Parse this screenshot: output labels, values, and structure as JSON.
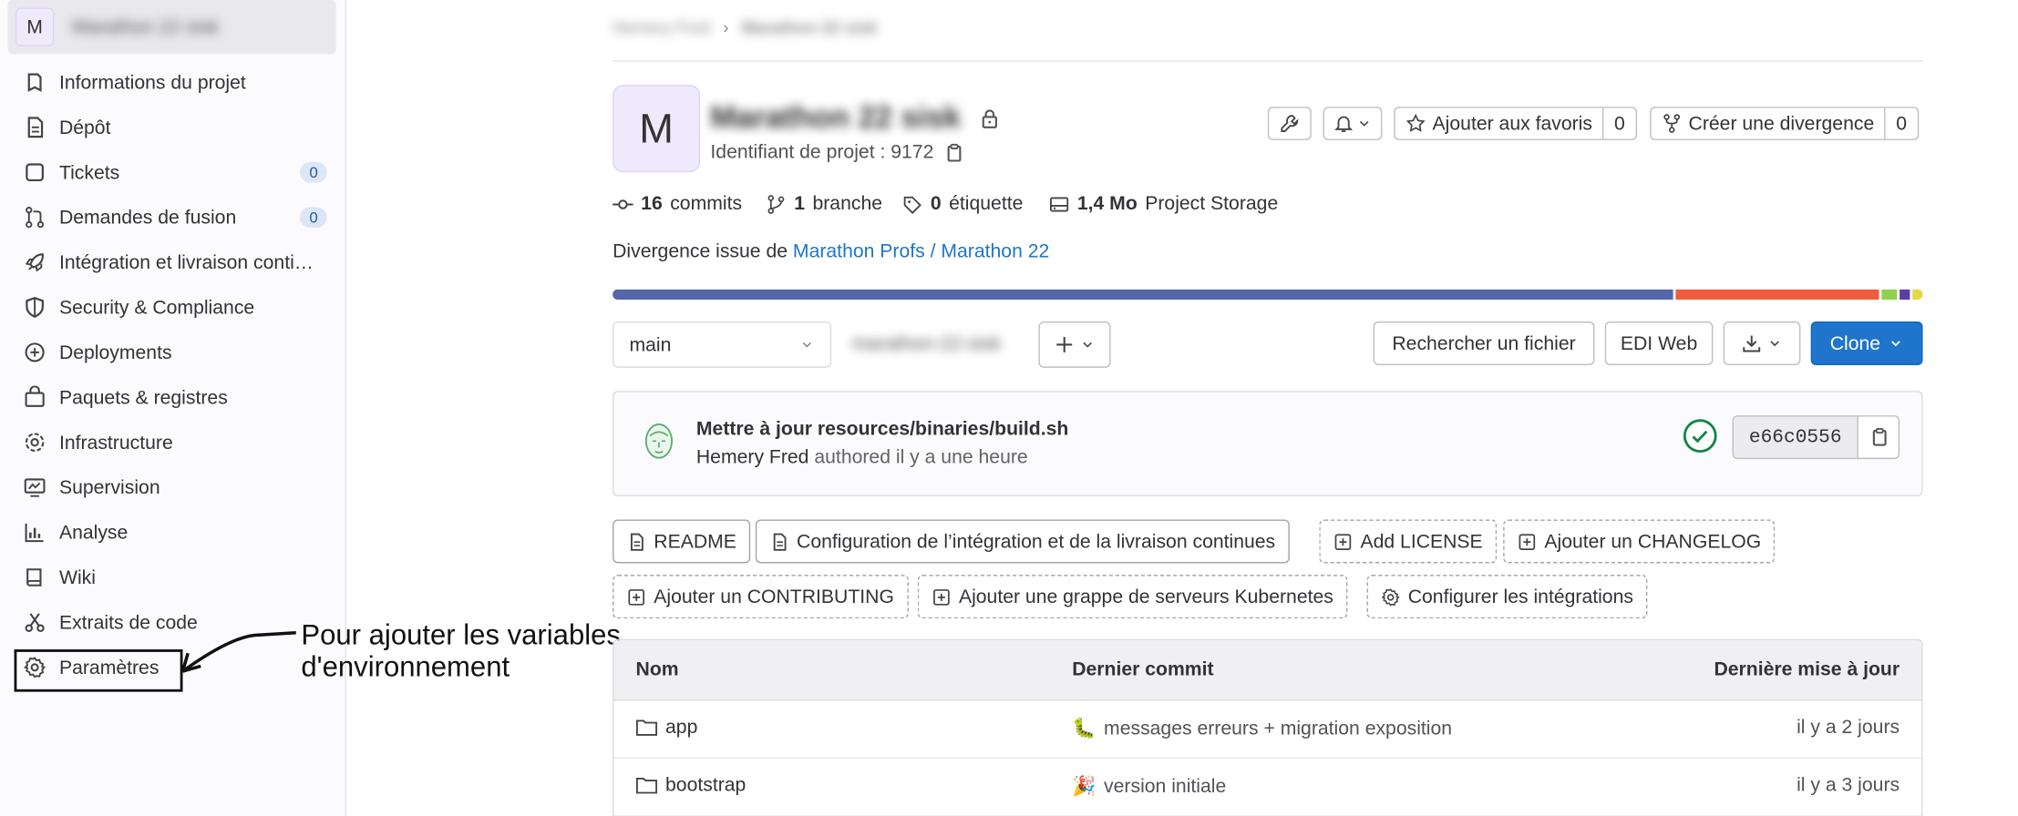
{
  "sidebar": {
    "context_avatar": "M",
    "context_name": "Marathon 22 sisk",
    "items": [
      {
        "label": "Informations du projet",
        "icon": "project-icon"
      },
      {
        "label": "Dépôt",
        "icon": "document-icon"
      },
      {
        "label": "Tickets",
        "icon": "issues-icon",
        "badge": "0"
      },
      {
        "label": "Demandes de fusion",
        "icon": "merge-request-icon",
        "badge": "0"
      },
      {
        "label": "Intégration et livraison conti…",
        "icon": "rocket-icon"
      },
      {
        "label": "Security & Compliance",
        "icon": "shield-icon"
      },
      {
        "label": "Deployments",
        "icon": "deployments-icon"
      },
      {
        "label": "Paquets & registres",
        "icon": "package-icon"
      },
      {
        "label": "Infrastructure",
        "icon": "cloud-gear-icon"
      },
      {
        "label": "Supervision",
        "icon": "monitor-icon"
      },
      {
        "label": "Analyse",
        "icon": "chart-icon"
      },
      {
        "label": "Wiki",
        "icon": "book-icon"
      },
      {
        "label": "Extraits de code",
        "icon": "snippet-icon"
      },
      {
        "label": "Paramètres",
        "icon": "gear-icon"
      }
    ]
  },
  "annotation": {
    "line1": "Pour ajouter les variables",
    "line2": "d'environnement"
  },
  "breadcrumb": {
    "parent": "Hemery Fred",
    "current": "Marathon 22 sisk"
  },
  "project": {
    "avatar": "M",
    "name": "Marathon 22 sisk",
    "id_label": "Identifiant de projet : 9172",
    "favorite_label": "Ajouter aux favoris",
    "favorite_count": "0",
    "fork_label": "Créer une divergence",
    "fork_count": "0"
  },
  "stats": {
    "commits_num": "16",
    "commits_label": "commits",
    "branches_num": "1",
    "branches_label": "branche",
    "tags_num": "0",
    "tags_label": "étiquette",
    "storage_num": "1,4 Mo",
    "storage_label": "Project Storage"
  },
  "fork_source": {
    "prefix": "Divergence issue de",
    "link": "Marathon Profs / Marathon 22"
  },
  "language_bar": [
    {
      "fraction": 0.81,
      "color": "#5467a8"
    },
    {
      "fraction": 0.155,
      "color": "#f05c3e"
    },
    {
      "fraction": 0.012,
      "color": "#8fd14f"
    },
    {
      "fraction": 0.008,
      "color": "#5b3fa3"
    },
    {
      "fraction": 0.008,
      "color": "#e3d943"
    }
  ],
  "toolbar": {
    "branch": "main",
    "path": "marathon-22-sisk",
    "find_file": "Rechercher un fichier",
    "web_ide": "EDI Web",
    "clone": "Clone"
  },
  "last_commit": {
    "title": "Mettre à jour resources/binaries/build.sh",
    "author": "Hemery Fred",
    "meta": "authored il y a une heure",
    "sha": "e66c0556"
  },
  "shortcuts": [
    "README",
    "Configuration de l’intégration et de la livraison continues",
    "Add LICENSE",
    "Ajouter un CHANGELOG",
    "Ajouter un CONTRIBUTING",
    "Ajouter une grappe de serveurs Kubernetes",
    "Configurer les intégrations"
  ],
  "table": {
    "headers": {
      "name": "Nom",
      "commit": "Dernier commit",
      "updated": "Dernière mise à jour"
    },
    "rows": [
      {
        "name": "app",
        "emoji": "🐛",
        "commit": "messages erreurs + migration exposition",
        "updated": "il y a 2 jours"
      },
      {
        "name": "bootstrap",
        "emoji": "🎉",
        "commit": "version initiale",
        "updated": "il y a 3 jours"
      }
    ]
  },
  "colors": {
    "primary": "#1f75cb",
    "link": "#1f75cb",
    "success": "#108548"
  }
}
